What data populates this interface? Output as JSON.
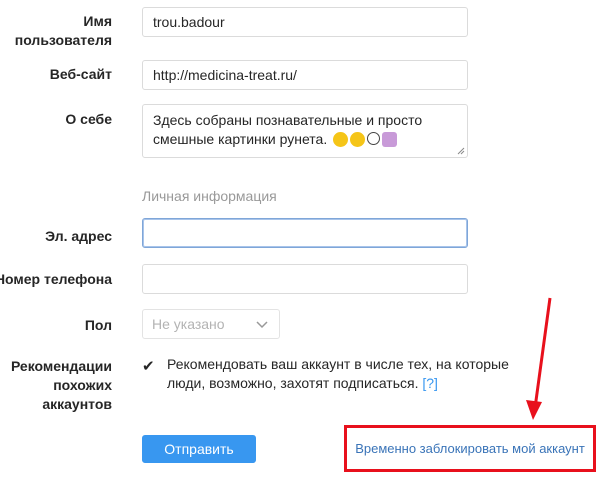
{
  "form": {
    "username": {
      "label": "Имя пользователя",
      "value": "trou.badour"
    },
    "website": {
      "label": "Веб-сайт",
      "value": "http://medicina-treat.ru/"
    },
    "bio": {
      "label": "О себе",
      "value": "Здесь собраны познавательные и просто смешные картинки рунета."
    },
    "private_section_title": "Личная информация",
    "email": {
      "label": "Эл. адрес",
      "value": ""
    },
    "phone": {
      "label": "Номер телефона",
      "value": ""
    },
    "gender": {
      "label": "Пол",
      "value": "Не указано"
    },
    "recommendations": {
      "label": "Рекомендации похожих аккаунтов",
      "checked": true,
      "text": "Рекомендовать ваш аккаунт в числе тех, на которые люди, возможно, захотят подписаться.",
      "help": "[?]"
    },
    "submit_label": "Отправить",
    "block_link": "Временно заблокировать мой аккаунт"
  },
  "colors": {
    "accent": "#3897f0",
    "highlight_box": "#e8101c",
    "arrow": "#e8101c",
    "link": "#3a74b8"
  },
  "icons": {
    "bio_emojis": [
      "grinning-face-icon",
      "smiling-face-icon",
      "smiley-icon",
      "person-raising-hand-icon"
    ],
    "gender_chevron": "chevron-down-icon",
    "annotation": "red-arrow-icon"
  }
}
